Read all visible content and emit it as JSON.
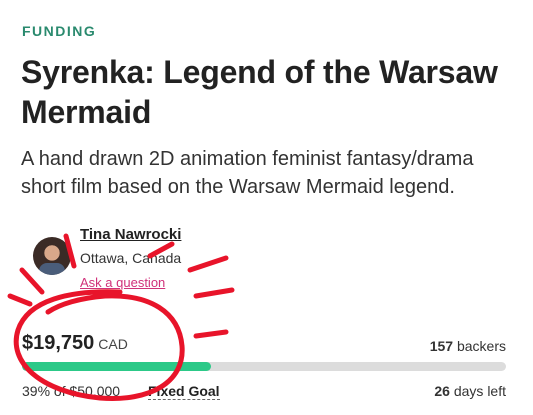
{
  "header": {
    "category": "FUNDING",
    "title": "Syrenka: Legend of the Warsaw Mermaid",
    "subtitle": "A hand drawn 2D animation feminist fantasy/drama short film based on the Warsaw Mermaid legend."
  },
  "creator": {
    "name": "Tina Nawrocki",
    "location": "Ottawa, Canada",
    "ask_link": "Ask a question"
  },
  "stats": {
    "pledged": "$19,750",
    "currency": "CAD",
    "backers_count": "157",
    "backers_label": "backers",
    "percent_text": "39% of $50,000",
    "goal_type": "Fixed Goal",
    "days_count": "26",
    "days_label": "days left",
    "progress_fraction": 0.39
  },
  "colors": {
    "category": "#2a8a6e",
    "progress_fill": "#2cc988",
    "progress_track": "#dcdcdc",
    "link": "#d0317a",
    "annotation": "#e8142a"
  }
}
